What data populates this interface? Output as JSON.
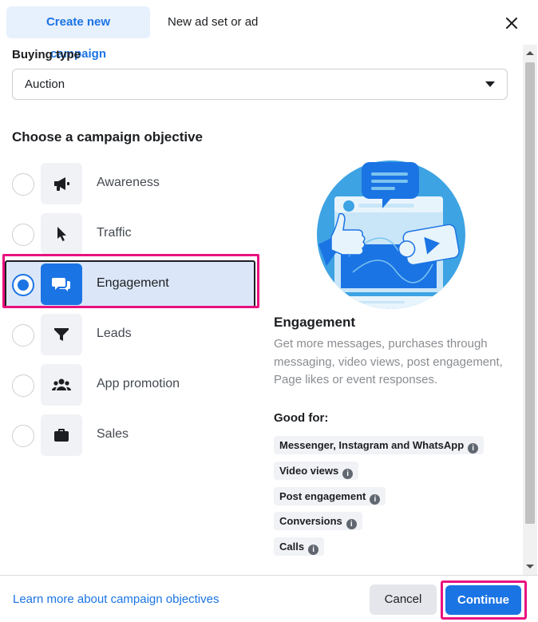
{
  "header": {
    "tab_active": "Create new campaign",
    "tab_other": "New ad set or ad",
    "close_icon": "close-icon"
  },
  "buying": {
    "label": "Buying type",
    "value": "Auction"
  },
  "objectives": {
    "title": "Choose a campaign objective",
    "items": [
      {
        "label": "Awareness",
        "icon": "megaphone-icon",
        "selected": false
      },
      {
        "label": "Traffic",
        "icon": "cursor-icon",
        "selected": false
      },
      {
        "label": "Engagement",
        "icon": "chat-bubbles-icon",
        "selected": true
      },
      {
        "label": "Leads",
        "icon": "filter-icon",
        "selected": false
      },
      {
        "label": "App promotion",
        "icon": "people-icon",
        "selected": false
      },
      {
        "label": "Sales",
        "icon": "briefcase-icon",
        "selected": false
      }
    ]
  },
  "detail": {
    "title": "Engagement",
    "description": "Get more messages, purchases through messaging, video views, post engagement, Page likes or event responses.",
    "good_for_label": "Good for:",
    "tags": [
      "Messenger, Instagram and WhatsApp",
      "Video views",
      "Post engagement",
      "Conversions",
      "Calls"
    ]
  },
  "footer": {
    "learn_link": "Learn more about campaign objectives",
    "cancel": "Cancel",
    "continue": "Continue"
  },
  "colors": {
    "accent": "#1b74e4",
    "highlight": "#e8117f",
    "selected_bg": "#dbe7f9"
  }
}
